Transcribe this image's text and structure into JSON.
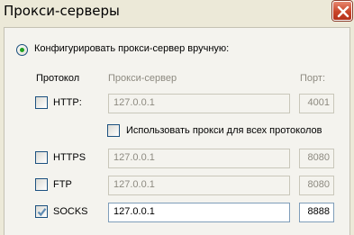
{
  "window": {
    "title": "Прокси-серверы"
  },
  "manual": {
    "label": "Конфигурировать прокси-сервер вручную:",
    "selected": true
  },
  "columns": {
    "protocol": "Протокол",
    "server": "Прокси-сервер",
    "port": "Порт:"
  },
  "http": {
    "label": "HTTP:",
    "checked": false,
    "server": "127.0.0.1",
    "port": "4001"
  },
  "use_for_all": {
    "label": "Использовать прокси для всех протоколов",
    "checked": false
  },
  "https": {
    "label": "HTTPS",
    "checked": false,
    "server": "127.0.0.1",
    "port": "8080"
  },
  "ftp": {
    "label": "FTP",
    "checked": false,
    "server": "127.0.0.1",
    "port": "8080"
  },
  "socks": {
    "label": "SOCKS",
    "checked": true,
    "server": "127.0.0.1",
    "port": "8888"
  },
  "icons": {
    "close": "close-icon",
    "check": "checkmark-icon"
  },
  "colors": {
    "close_button": "#c9452a",
    "radio_dot": "#21a121",
    "checkbox_border": "#1c5180"
  }
}
